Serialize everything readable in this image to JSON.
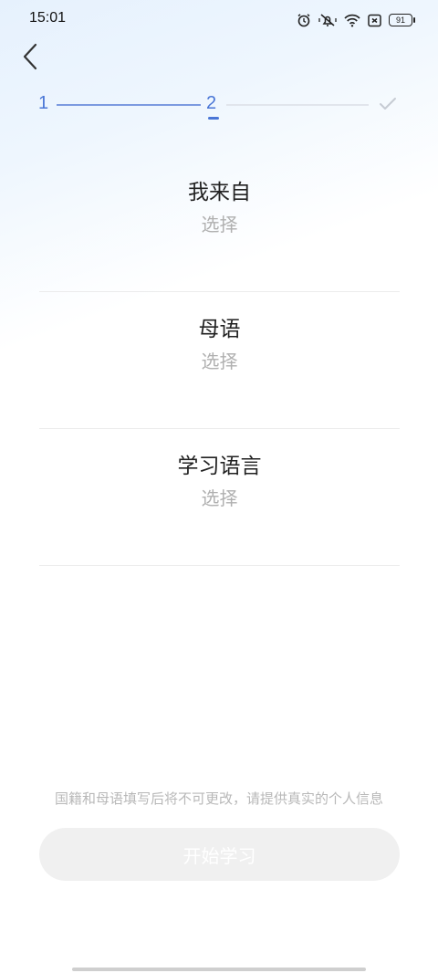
{
  "status_bar": {
    "time": "15:01",
    "battery_level": "91",
    "icons": [
      "alarm-icon",
      "vibrate-mute-icon",
      "wifi-icon",
      "sim-none-icon",
      "battery-icon"
    ]
  },
  "stepper": {
    "step1": "1",
    "step2": "2",
    "active_step": 2,
    "final_icon": "check-icon",
    "accent_color": "#4a76d6"
  },
  "fields": {
    "origin": {
      "label": "我来自",
      "value": "选择"
    },
    "native_language": {
      "label": "母语",
      "value": "选择"
    },
    "learning_language": {
      "label": "学习语言",
      "value": "选择"
    }
  },
  "notice": "国籍和母语填写后将不可更改，请提供真实的个人信息",
  "start_button": {
    "label": "开始学习",
    "enabled": false
  }
}
